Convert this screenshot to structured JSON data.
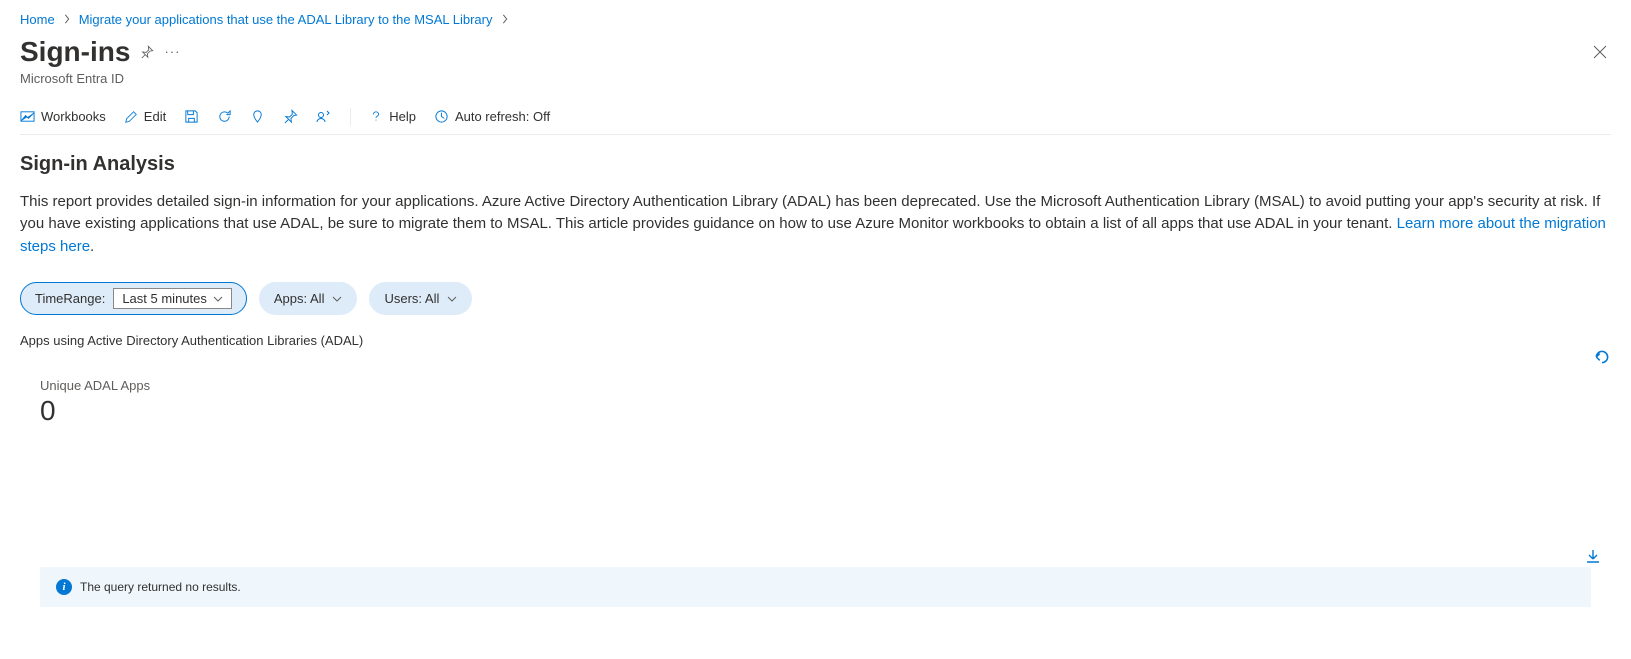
{
  "breadcrumb": {
    "home": "Home",
    "item2": "Migrate your applications that use the ADAL Library to the MSAL Library"
  },
  "header": {
    "title": "Sign-ins",
    "subtitle": "Microsoft Entra ID"
  },
  "toolbar": {
    "workbooks": "Workbooks",
    "edit": "Edit",
    "help": "Help",
    "auto_refresh": "Auto refresh: Off"
  },
  "content": {
    "section_title": "Sign-in Analysis",
    "description_part1": "This report provides detailed sign-in information for your applications. Azure Active Directory Authentication Library (ADAL) has been deprecated. Use the Microsoft Authentication Library (MSAL) to avoid putting your app's security at risk. If you have existing applications that use ADAL, be sure to migrate them to MSAL. This article provides guidance on how to use Azure Monitor workbooks to obtain a list of all apps that use ADAL in your tenant. ",
    "learn_more": "Learn more about the migration steps here",
    "subsection": "Apps using Active Directory Authentication Libraries (ADAL)"
  },
  "filters": {
    "time_range_label": "TimeRange:",
    "time_range_value": "Last 5 minutes",
    "apps_label": "Apps: All",
    "users_label": "Users: All"
  },
  "metric": {
    "label": "Unique ADAL Apps",
    "value": "0"
  },
  "info": {
    "message": "The query returned no results."
  }
}
